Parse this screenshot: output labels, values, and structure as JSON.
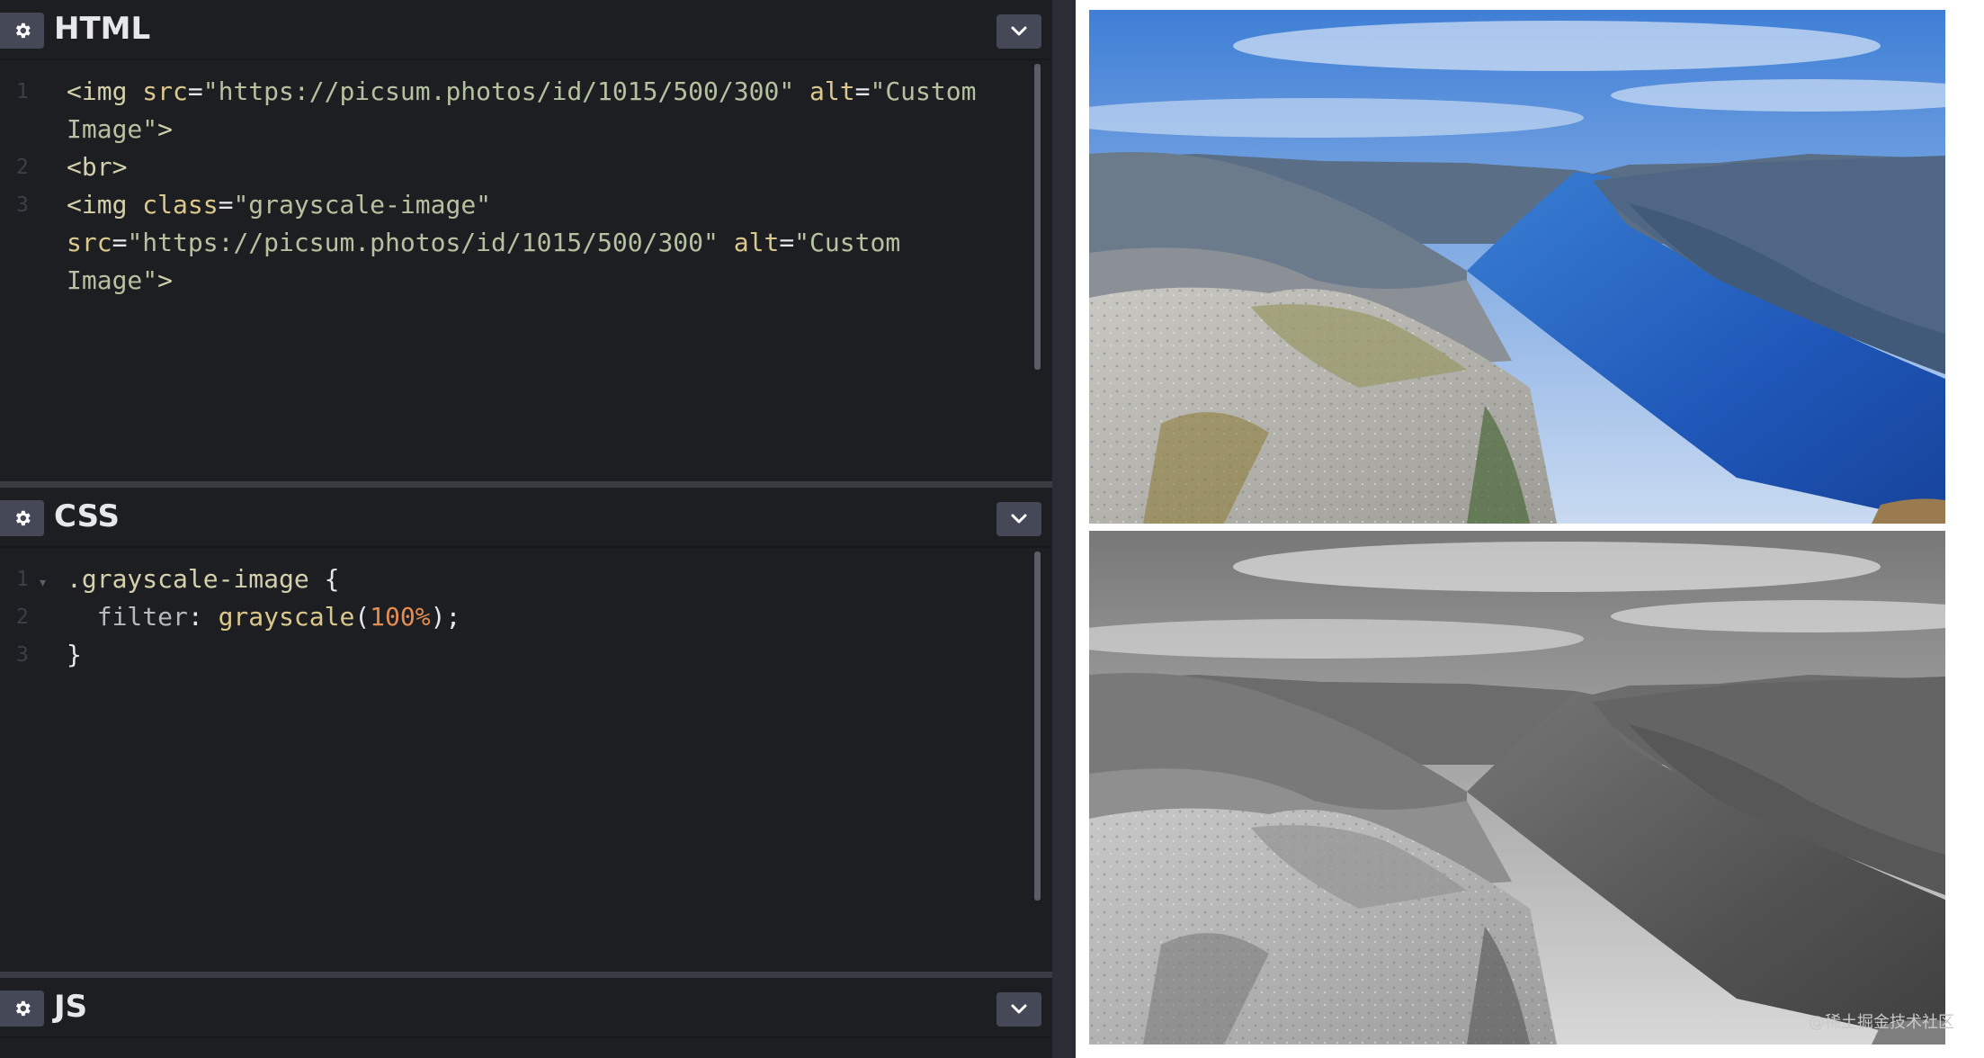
{
  "panels": {
    "html": {
      "title": "HTML",
      "lines": [
        {
          "num": "1",
          "segments": [
            {
              "cls": "tok-tag",
              "text": "<img "
            },
            {
              "cls": "tok-attr",
              "text": "src"
            },
            {
              "cls": "tok-punc",
              "text": "="
            },
            {
              "cls": "tok-str",
              "text": "\"https://picsum.photos/id/1015/500/300\" "
            },
            {
              "cls": "tok-attr",
              "text": "alt"
            },
            {
              "cls": "tok-punc",
              "text": "="
            },
            {
              "cls": "tok-str",
              "text": "\"Custom"
            }
          ]
        },
        {
          "num": "",
          "segments": [
            {
              "cls": "tok-str",
              "text": "Image\""
            },
            {
              "cls": "tok-tag",
              "text": ">"
            }
          ]
        },
        {
          "num": "2",
          "segments": [
            {
              "cls": "tok-tag",
              "text": "<br>"
            }
          ]
        },
        {
          "num": "3",
          "segments": [
            {
              "cls": "tok-tag",
              "text": "<img "
            },
            {
              "cls": "tok-attr",
              "text": "class"
            },
            {
              "cls": "tok-punc",
              "text": "="
            },
            {
              "cls": "tok-str",
              "text": "\"grayscale-image\""
            }
          ]
        },
        {
          "num": "",
          "segments": [
            {
              "cls": "tok-attr",
              "text": "src"
            },
            {
              "cls": "tok-punc",
              "text": "="
            },
            {
              "cls": "tok-str",
              "text": "\"https://picsum.photos/id/1015/500/300\" "
            },
            {
              "cls": "tok-attr",
              "text": "alt"
            },
            {
              "cls": "tok-punc",
              "text": "="
            },
            {
              "cls": "tok-str",
              "text": "\"Custom"
            }
          ]
        },
        {
          "num": "",
          "segments": [
            {
              "cls": "tok-str",
              "text": "Image\""
            },
            {
              "cls": "tok-tag",
              "text": ">"
            }
          ]
        }
      ]
    },
    "css": {
      "title": "CSS",
      "lines": [
        {
          "num": "1",
          "fold": "▾",
          "segments": [
            {
              "cls": "tok-sel",
              "text": ".grayscale-image "
            },
            {
              "cls": "tok-punc",
              "text": "{"
            }
          ]
        },
        {
          "num": "2",
          "segments": [
            {
              "cls": "tok-prop",
              "text": "  filter"
            },
            {
              "cls": "tok-punc",
              "text": ": "
            },
            {
              "cls": "tok-fn",
              "text": "grayscale"
            },
            {
              "cls": "tok-punc",
              "text": "("
            },
            {
              "cls": "tok-num",
              "text": "100%"
            },
            {
              "cls": "tok-punc",
              "text": ");"
            }
          ]
        },
        {
          "num": "3",
          "segments": [
            {
              "cls": "tok-punc",
              "text": "}"
            }
          ]
        }
      ]
    },
    "js": {
      "title": "JS",
      "lines": []
    }
  },
  "icons": {
    "settings": "gear-icon",
    "collapse": "chevron-down-icon"
  },
  "preview": {
    "images": [
      {
        "alt": "Custom Image",
        "filter": "none"
      },
      {
        "alt": "Custom Image",
        "filter": "grayscale(100%)"
      }
    ],
    "watermark": "@稀土掘金技术社区"
  },
  "colors": {
    "editor_bg": "#1d1e22",
    "button_bg": "#444857",
    "resizer": "#2b2d34",
    "preview_bg": "#ffffff"
  }
}
